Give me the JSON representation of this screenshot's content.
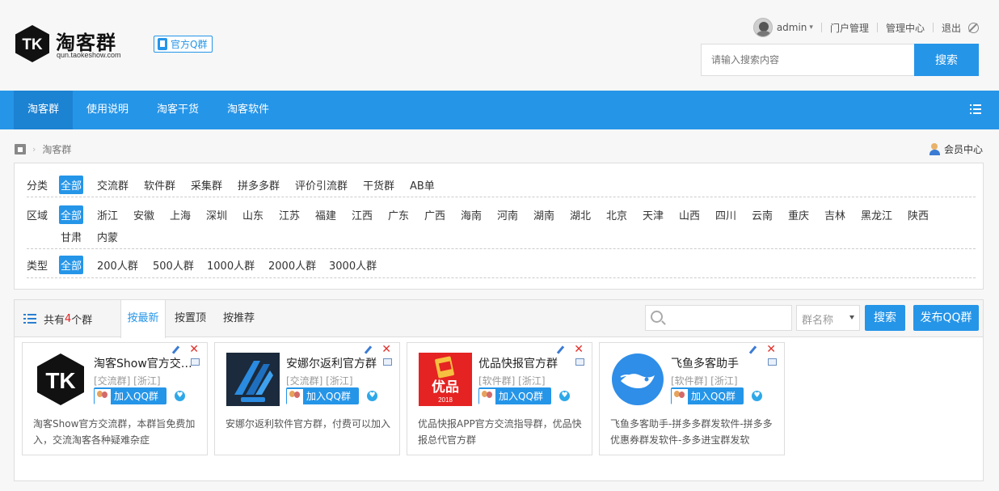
{
  "header": {
    "logo_text": "淘客群",
    "logo_sub": "qun.taokeshow.com",
    "qq_badge": "官方Q群",
    "user": "admin",
    "links": [
      "门户管理",
      "管理中心",
      "退出"
    ],
    "search_placeholder": "请输入搜索内容",
    "search_button": "搜索"
  },
  "nav": {
    "items": [
      "淘客群",
      "使用说明",
      "淘客干货",
      "淘客软件"
    ]
  },
  "breadcrumb": {
    "current": "淘客群",
    "member": "会员中心"
  },
  "filters": {
    "category": {
      "label": "分类",
      "items": [
        "全部",
        "交流群",
        "软件群",
        "采集群",
        "拼多多群",
        "评价引流群",
        "干货群",
        "AB单"
      ]
    },
    "region": {
      "label": "区域",
      "items": [
        "全部",
        "浙江",
        "安徽",
        "上海",
        "深圳",
        "山东",
        "江苏",
        "福建",
        "江西",
        "广东",
        "广西",
        "海南",
        "河南",
        "湖南",
        "湖北",
        "北京",
        "天津",
        "山西",
        "四川",
        "云南",
        "重庆",
        "吉林",
        "黑龙江",
        "陕西",
        "甘肃",
        "内蒙"
      ]
    },
    "type": {
      "label": "类型",
      "items": [
        "全部",
        "200人群",
        "500人群",
        "1000人群",
        "2000人群",
        "3000人群"
      ]
    }
  },
  "list": {
    "count_prefix": "共有",
    "count": "4",
    "count_suffix": "个群",
    "tabs": [
      "按最新",
      "按置顶",
      "按推荐"
    ],
    "select_value": "群名称",
    "search_button": "搜索",
    "publish_button": "发布QQ群",
    "join_label": "加入QQ群",
    "cards": [
      {
        "name": "淘客Show官方交流群",
        "tags": "[交流群] [浙江]",
        "desc": "淘客Show官方交流群，本群旨免费加入，交流淘客各种疑难杂症",
        "logo": "tk-logo"
      },
      {
        "name": "安娜尔返利官方群",
        "tags": "[交流群] [浙江]",
        "desc": "安娜尔返利软件官方群，付费可以加入",
        "logo": "anna-logo"
      },
      {
        "name": "优品快报官方群",
        "tags": "[软件群] [浙江]",
        "desc": "优品快报APP官方交流指导群，优品快报总代官方群",
        "logo": "youpin-logo"
      },
      {
        "name": "飞鱼多客助手",
        "tags": "[软件群] [浙江]",
        "desc": "飞鱼多客助手-拼多多群发软件-拼多多优惠券群发软件-多多进宝群发软",
        "logo": "feiyu-logo"
      }
    ]
  },
  "colors": {
    "primary": "#2595e8",
    "nav_active": "#1c82d2",
    "count_red": "#e02020"
  }
}
